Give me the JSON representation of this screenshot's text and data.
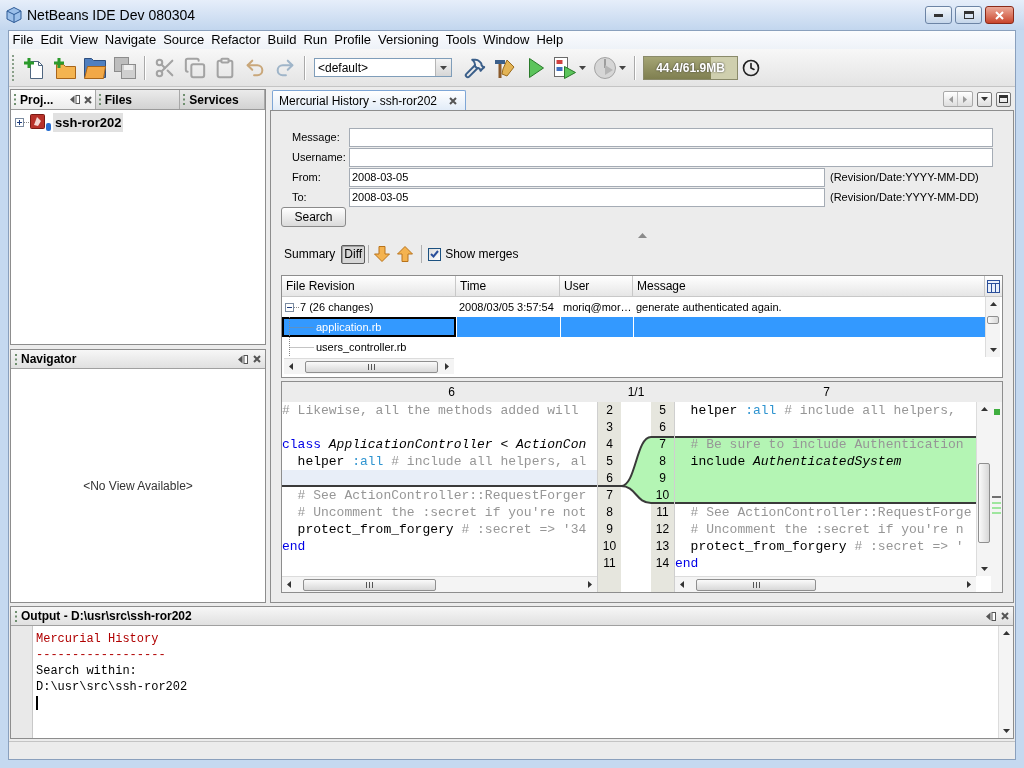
{
  "window": {
    "title": "NetBeans IDE Dev 080304"
  },
  "menu": [
    "File",
    "Edit",
    "View",
    "Navigate",
    "Source",
    "Refactor",
    "Build",
    "Run",
    "Profile",
    "Versioning",
    "Tools",
    "Window",
    "Help"
  ],
  "toolbar": {
    "items": [
      {
        "kind": "new-file",
        "disabled": false
      },
      {
        "kind": "new-project",
        "disabled": false
      },
      {
        "kind": "open-project",
        "disabled": false
      },
      {
        "kind": "save-all",
        "disabled": true
      },
      {
        "kind": "separator"
      },
      {
        "kind": "cut",
        "disabled": true
      },
      {
        "kind": "copy",
        "disabled": true
      },
      {
        "kind": "paste",
        "disabled": true
      },
      {
        "kind": "undo",
        "disabled": true
      },
      {
        "kind": "redo",
        "disabled": true
      },
      {
        "kind": "separator"
      },
      {
        "kind": "config",
        "value": "<default>"
      },
      {
        "kind": "build",
        "disabled": false
      },
      {
        "kind": "clean-build",
        "disabled": false
      },
      {
        "kind": "run",
        "disabled": false
      },
      {
        "kind": "debug",
        "disabled": false,
        "menu": true
      },
      {
        "kind": "profile",
        "disabled": true,
        "menu": true
      },
      {
        "kind": "separator"
      },
      {
        "kind": "memory",
        "reading": "44.4/61.9MB",
        "level": 0.72
      },
      {
        "kind": "gc",
        "disabled": false
      }
    ]
  },
  "projects_panel": {
    "tabs": [
      {
        "label": "Proj...",
        "selected": true
      },
      {
        "label": "Files",
        "selected": false
      },
      {
        "label": "Services",
        "selected": false
      }
    ],
    "tree": [
      {
        "label": "ssh-ror202",
        "expanded": false,
        "selected": true
      }
    ]
  },
  "navigator": {
    "title": "Navigator",
    "message": "<No View Available>"
  },
  "editor": {
    "tabs": [
      {
        "label": "Mercurial History - ssh-ror202",
        "selected": true
      }
    ],
    "fields": [
      {
        "label": "Message:"
      },
      {
        "label": "Username:"
      },
      {
        "label": "From:",
        "value": "2008-03-05",
        "hint": "(Revision/Date:YYYY-MM-DD)"
      },
      {
        "label": "To:",
        "value": "2008-03-05",
        "hint": "(Revision/Date:YYYY-MM-DD)"
      }
    ],
    "search_button": "Search",
    "view_toggle": [
      {
        "label": "Summary",
        "selected": false
      },
      {
        "label": "Diff",
        "selected": true
      }
    ],
    "show_merges": {
      "label": "Show merges",
      "checked": true
    },
    "table": {
      "columns": [
        "File Revision",
        "Time",
        "User",
        "Message"
      ],
      "rows": [
        {
          "revision": "7 (26 changes)",
          "time": "2008/03/05 3:57:54",
          "user": "moriq@mor…",
          "message": "generate authenticated again.",
          "expanded": true,
          "selected": false,
          "children": [
            {
              "file": "application.rb",
              "selected": true
            },
            {
              "file": "users_controller.rb",
              "selected": false
            }
          ]
        }
      ]
    },
    "diff": {
      "left_title": "6",
      "position": "1/1",
      "right_title": "7",
      "left_lines": [
        {
          "number": "2",
          "kind": "normal",
          "parts": [
            {
              "kind": "comment",
              "text": "# Likewise, all the methods added will"
            }
          ]
        },
        {
          "number": "3",
          "kind": "normal"
        },
        {
          "number": "4",
          "kind": "normal",
          "parts": [
            {
              "kind": "keyword",
              "text": "class"
            },
            {
              "kind": "constant",
              "text": " ApplicationController"
            },
            {
              "kind": "plain",
              "text": " < "
            },
            {
              "kind": "constant",
              "text": "ActionCon"
            }
          ]
        },
        {
          "number": "5",
          "kind": "normal",
          "parts": [
            {
              "kind": "plain",
              "text": "  helper "
            },
            {
              "kind": "symbol",
              "text": ":all"
            },
            {
              "kind": "comment",
              "text": " # include all helpers, al"
            }
          ]
        },
        {
          "number": "6",
          "kind": "anchor"
        },
        {
          "number": "7",
          "kind": "normal",
          "parts": [
            {
              "kind": "comment",
              "text": "  # See ActionController::RequestForger"
            }
          ]
        },
        {
          "number": "8",
          "kind": "normal",
          "parts": [
            {
              "kind": "comment",
              "text": "  # Uncomment the :secret if you're not"
            }
          ]
        },
        {
          "number": "9",
          "kind": "normal",
          "parts": [
            {
              "kind": "plain",
              "text": "  protect_from_forgery "
            },
            {
              "kind": "comment",
              "text": "# :secret => '34"
            }
          ]
        },
        {
          "number": "10",
          "kind": "normal",
          "parts": [
            {
              "kind": "keyword",
              "text": "end"
            }
          ]
        },
        {
          "number": "11",
          "kind": "normal"
        }
      ],
      "right_lines": [
        {
          "number": "5",
          "kind": "normal",
          "parts": [
            {
              "kind": "plain",
              "text": "  helper "
            },
            {
              "kind": "symbol",
              "text": ":all"
            },
            {
              "kind": "comment",
              "text": " # include all helpers,"
            }
          ]
        },
        {
          "number": "6",
          "kind": "normal"
        },
        {
          "number": "7",
          "kind": "added",
          "parts": [
            {
              "kind": "comment",
              "text": "  # Be sure to include Authentication"
            }
          ]
        },
        {
          "number": "8",
          "kind": "added",
          "parts": [
            {
              "kind": "plain",
              "text": "  include "
            },
            {
              "kind": "constant",
              "text": "AuthenticatedSystem"
            }
          ]
        },
        {
          "number": "9",
          "kind": "added"
        },
        {
          "number": "10",
          "kind": "added"
        },
        {
          "number": "11",
          "kind": "normal",
          "parts": [
            {
              "kind": "comment",
              "text": "  # See ActionController::RequestForge"
            }
          ]
        },
        {
          "number": "12",
          "kind": "normal",
          "parts": [
            {
              "kind": "comment",
              "text": "  # Uncomment the :secret if you're n"
            }
          ]
        },
        {
          "number": "13",
          "kind": "normal",
          "parts": [
            {
              "kind": "plain",
              "text": "  protect_from_forgery "
            },
            {
              "kind": "comment",
              "text": "# :secret => '"
            }
          ]
        },
        {
          "number": "14",
          "kind": "normal",
          "parts": [
            {
              "kind": "keyword",
              "text": "end"
            }
          ]
        }
      ]
    }
  },
  "output": {
    "title": "Output - D:\\usr\\src\\ssh-ror202",
    "lines": [
      {
        "kind": "heading",
        "text": "Mercurial History"
      },
      {
        "kind": "heading",
        "text": "------------------"
      },
      {
        "kind": "plain",
        "text": "Search within:"
      },
      {
        "kind": "plain",
        "text": "D:\\usr\\src\\ssh-ror202"
      }
    ]
  }
}
